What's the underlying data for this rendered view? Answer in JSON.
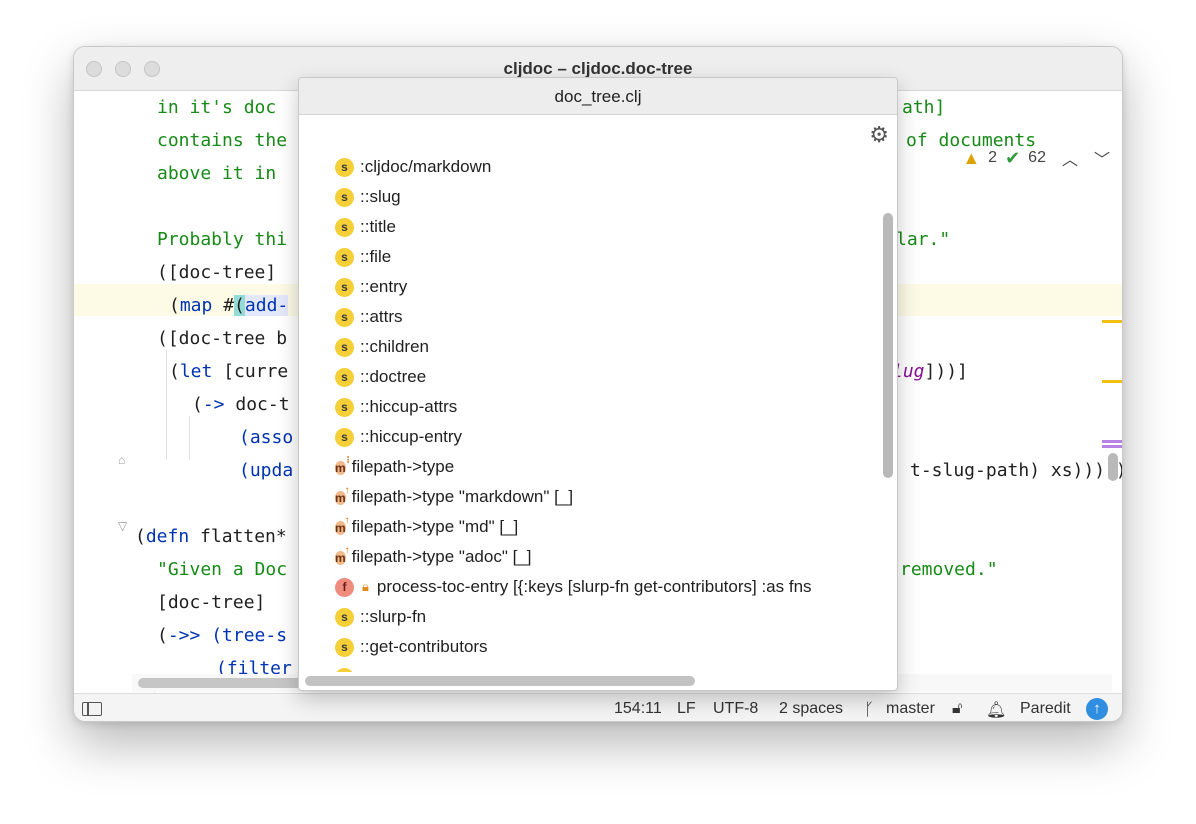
{
  "window": {
    "title": "cljdoc – cljdoc.doc-tree"
  },
  "editor": {
    "lines": [
      {
        "text": "in it's doc",
        "tail": "ath]"
      },
      {
        "text": "contains the",
        "tail": "of documents"
      },
      {
        "text": "above it in",
        "tail": ""
      },
      {
        "text": "Probably thi",
        "tail": "lar.\""
      },
      {
        "text": "([doc-tree]",
        "tail": ""
      },
      {
        "text_a": "(map #",
        "text_b": "(",
        "text_c": "add-",
        "tail": ""
      },
      {
        "text": "([doc-tree b",
        "tail": ""
      },
      {
        "text_a": "(",
        "text_b": "let",
        "text_c": " [curre",
        "tail_sym": "lug",
        "tail": "]))]"
      },
      {
        "text_a": "(",
        "text_b": "->",
        "text_c": " doc-t",
        "tail": ""
      },
      {
        "text": "(asso",
        "tail": ""
      },
      {
        "text": "(upda",
        "tail": "t-slug-path) xs)))))"
      },
      {
        "text_a": "(",
        "text_b": "defn",
        "text_c": " flatten*",
        "tail": ""
      },
      {
        "text": "\"Given a Doc",
        "tail": "removed.\""
      },
      {
        "text": "[doc-tree]",
        "tail": ""
      },
      {
        "text_a": "(",
        "text_b": "->>",
        "text_c": " (tree-s",
        "tail": ""
      },
      {
        "text": "(filter",
        "tail": ""
      }
    ],
    "inspections": {
      "warnings": "2",
      "ok": "62"
    }
  },
  "popup": {
    "title": "doc_tree.clj",
    "items": [
      {
        "kind": "s",
        "label": ":cljdoc/markdown"
      },
      {
        "kind": "s",
        "label": "::slug"
      },
      {
        "kind": "s",
        "label": "::title"
      },
      {
        "kind": "s",
        "label": "::file"
      },
      {
        "kind": "s",
        "label": "::entry"
      },
      {
        "kind": "s",
        "label": "::attrs"
      },
      {
        "kind": "s",
        "label": "::children"
      },
      {
        "kind": "s",
        "label": "::doctree"
      },
      {
        "kind": "s",
        "label": "::hiccup-attrs"
      },
      {
        "kind": "s",
        "label": "::hiccup-entry"
      },
      {
        "kind": "m",
        "label": "filepath->type"
      },
      {
        "kind": "m",
        "label": "filepath->type \"markdown\" [_]"
      },
      {
        "kind": "m",
        "label": "filepath->type \"md\" [_]"
      },
      {
        "kind": "m",
        "label": "filepath->type \"adoc\" [_]"
      },
      {
        "kind": "f",
        "label": "process-toc-entry [{:keys [slurp-fn get-contributors] :as fns"
      },
      {
        "kind": "s",
        "label": "::slurp-fn"
      },
      {
        "kind": "s",
        "label": "::get-contributors"
      }
    ]
  },
  "statusbar": {
    "position": "154:11",
    "line_separator": "LF",
    "encoding": "UTF-8",
    "indent": "2 spaces",
    "branch": "master",
    "mode": "Paredit"
  }
}
